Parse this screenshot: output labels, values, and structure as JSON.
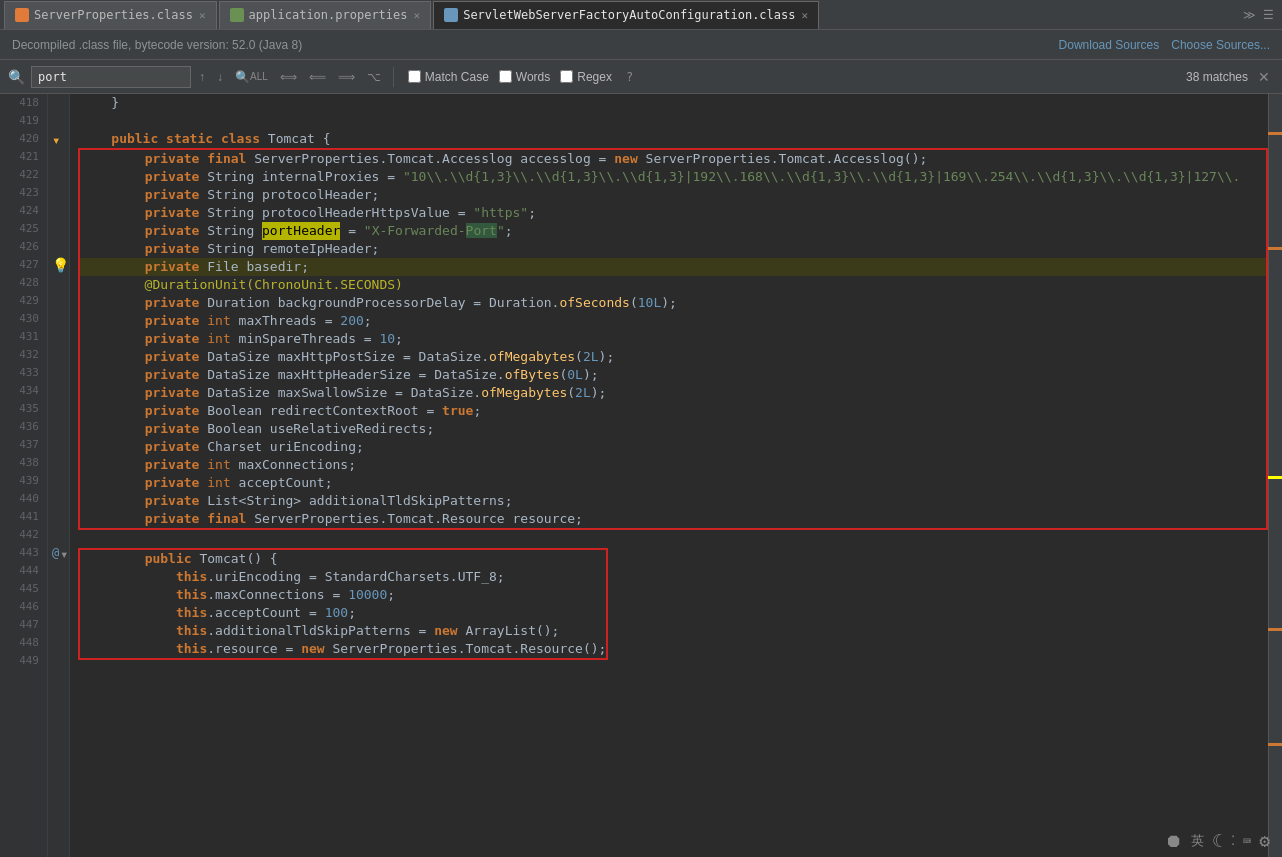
{
  "tabs": [
    {
      "id": "tab1",
      "label": "ServerProperties.class",
      "icon": "orange",
      "active": false
    },
    {
      "id": "tab2",
      "label": "application.properties",
      "icon": "green",
      "active": false
    },
    {
      "id": "tab3",
      "label": "ServletWebServerFactoryAutoConfiguration.class",
      "icon": "blue",
      "active": true
    }
  ],
  "tab_end": "≫ ☰",
  "info_bar": {
    "text": "Decompiled .class file, bytecode version: 52.0 (Java 8)",
    "download_sources": "Download Sources",
    "choose_sources": "Choose Sources..."
  },
  "search_bar": {
    "query": "port",
    "match_case_label": "Match Case",
    "words_label": "Words",
    "regex_label": "Regex",
    "help": "?",
    "match_count": "38 matches"
  },
  "line_numbers": [
    418,
    419,
    420,
    421,
    422,
    423,
    424,
    425,
    426,
    427,
    428,
    429,
    430,
    431,
    432,
    433,
    434,
    435,
    436,
    437,
    438,
    439,
    440,
    441,
    442,
    443,
    444,
    445,
    446,
    447,
    448,
    449
  ],
  "code_lines": [
    {
      "num": 418,
      "content": "    }"
    },
    {
      "num": 419,
      "content": ""
    },
    {
      "num": 420,
      "content": "    public static class Tomcat {",
      "has_fold": true
    },
    {
      "num": 421,
      "content": "        private final ServerProperties.Tomcat.Accesslog accesslog = new ServerProperties.Tomcat.Accesslog();"
    },
    {
      "num": 422,
      "content": "        private String internalProxies = \"10\\\\.\\\\d{1,3}\\\\.\\\\d{1,3}\\\\.\\\\d{1,3}|192\\\\.168\\\\.\\\\d{1,3}\\\\.\\\\d{1,3}|169\\\\.254\\\\.\\\\d{1,3}\\\\.\\\\d{1,3}|127\\\\."
    },
    {
      "num": 423,
      "content": "        private String protocolHeader;"
    },
    {
      "num": 424,
      "content": "        private String protocolHeaderHttpsValue = \"https\";"
    },
    {
      "num": 425,
      "content": "        private String portHeader = \"X-Forwarded-Port\";",
      "highlight_port": true
    },
    {
      "num": 426,
      "content": "        private String remoteIpHeader;"
    },
    {
      "num": 427,
      "content": "        private File basedir;",
      "has_marker": true
    },
    {
      "num": 428,
      "content": "        @DurationUnit(ChronoUnit.SECONDS)"
    },
    {
      "num": 429,
      "content": "        private Duration backgroundProcessorDelay = Duration.ofSeconds(10L);"
    },
    {
      "num": 430,
      "content": "        private int maxThreads = 200;"
    },
    {
      "num": 431,
      "content": "        private int minSpareThreads = 10;"
    },
    {
      "num": 432,
      "content": "        private DataSize maxHttpPostSize = DataSize.ofMegabytes(2L);"
    },
    {
      "num": 433,
      "content": "        private DataSize maxHttpHeaderSize = DataSize.ofBytes(0L);"
    },
    {
      "num": 434,
      "content": "        private DataSize maxSwallowSize = DataSize.ofMegabytes(2L);"
    },
    {
      "num": 435,
      "content": "        private Boolean redirectContextRoot = true;"
    },
    {
      "num": 436,
      "content": "        private Boolean useRelativeRedirects;"
    },
    {
      "num": 437,
      "content": "        private Charset uriEncoding;"
    },
    {
      "num": 438,
      "content": "        private int maxConnections;"
    },
    {
      "num": 439,
      "content": "        private int acceptCount;"
    },
    {
      "num": 440,
      "content": "        private List<String> additionalTldSkipPatterns;"
    },
    {
      "num": 441,
      "content": "        private final ServerProperties.Tomcat.Resource resource;"
    },
    {
      "num": 442,
      "content": ""
    },
    {
      "num": 443,
      "content": "        public Tomcat() {",
      "has_at": true,
      "has_fold2": true
    },
    {
      "num": 444,
      "content": "            this.uriEncoding = StandardCharsets.UTF_8;"
    },
    {
      "num": 445,
      "content": "            this.maxConnections = 10000;"
    },
    {
      "num": 446,
      "content": "            this.acceptCount = 100;"
    },
    {
      "num": 447,
      "content": "            this.additionalTldSkipPatterns = new ArrayList();"
    },
    {
      "num": 448,
      "content": "            this.resource = new ServerProperties.Tomcat.Resource();"
    },
    {
      "num": 449,
      "content": ""
    }
  ],
  "tray_icons": [
    "⏺",
    "英",
    "☾",
    "⁇",
    "⌨",
    "⚙"
  ]
}
